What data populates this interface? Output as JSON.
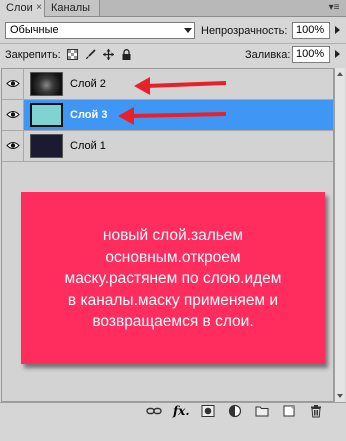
{
  "tabs": [
    {
      "label": "Слои",
      "active": true
    },
    {
      "label": "Каналы",
      "active": false
    }
  ],
  "tab_close_glyph": "×",
  "panel_menu_glyph": "▾≡",
  "blend_mode": {
    "value": "Обычные"
  },
  "opacity": {
    "label": "Непрозрачность:",
    "value": "100%"
  },
  "lock": {
    "label": "Закрепить:",
    "icons": [
      "lock-transparent-icon",
      "lock-pixels-icon",
      "lock-position-icon",
      "lock-all-icon"
    ]
  },
  "fill": {
    "label": "Заливка:",
    "value": "100%"
  },
  "layers": [
    {
      "name": "Слой 2",
      "selected": false,
      "thumb": "dark-image",
      "arrow": true
    },
    {
      "name": "Слой 3",
      "selected": true,
      "thumb": "teal",
      "arrow": true
    },
    {
      "name": "Слой 1",
      "selected": false,
      "thumb": "navy",
      "arrow": false
    }
  ],
  "colors": {
    "selected_row": "#3f96f5",
    "arrow": "#e8202a",
    "note_bg": "#ff2c5e",
    "thumb_teal": "#7fd3d3",
    "thumb_navy": "#1a1a30"
  },
  "note": {
    "lines": [
      "новый слой.зальем",
      "основным.откроем",
      "маску.растянем по слою.идем",
      "в каналы.маску применяем и",
      "возвращаемся в слои."
    ]
  },
  "toolbar": {
    "fx_label": "fx.",
    "icons": [
      "link-layers-icon",
      "fx-style-icon",
      "add-mask-icon",
      "adjustment-layer-icon",
      "new-group-icon",
      "new-layer-icon",
      "trash-icon"
    ]
  }
}
